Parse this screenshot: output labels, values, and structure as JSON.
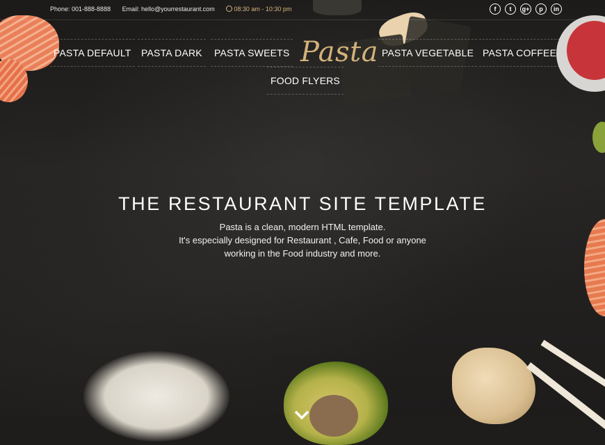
{
  "topbar": {
    "phone": "Phone: 001-888-8888",
    "email": "Email: hello@yourrestaurant.com",
    "hours": "08:30 am - 10:30 pm",
    "social": [
      {
        "icon": "facebook-icon",
        "glyph": "f"
      },
      {
        "icon": "twitter-icon",
        "glyph": "t"
      },
      {
        "icon": "google-plus-icon",
        "glyph": "g+"
      },
      {
        "icon": "pinterest-icon",
        "glyph": "p"
      },
      {
        "icon": "linkedin-icon",
        "glyph": "in"
      }
    ]
  },
  "nav": {
    "items": [
      "PASTA DEFAULT",
      "PASTA DARK",
      "PASTA SWEETS",
      "PASTA VEGETABLE",
      "PASTA COFFEE",
      "FOOD FLYERS"
    ],
    "logo": "Pasta"
  },
  "hero": {
    "title": "THE RESTAURANT SITE TEMPLATE",
    "line1": "Pasta is a clean, modern HTML template.",
    "line2": "It's especially designed for Restaurant , Cafe, Food or anyone",
    "line3": "working in the Food industry and more."
  },
  "colors": {
    "accent": "#d3b27a",
    "background": "#1f1d1c"
  }
}
